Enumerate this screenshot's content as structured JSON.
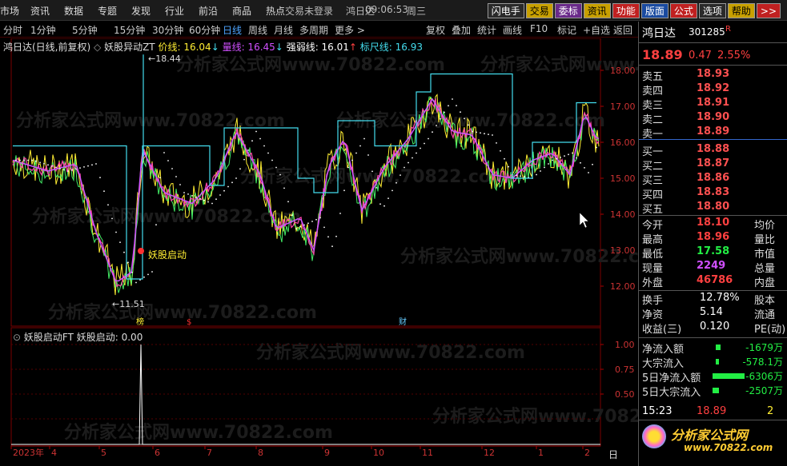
{
  "menubar": {
    "items": [
      "市场",
      "资讯",
      "数据",
      "专题",
      "发现",
      "行业",
      "前沿",
      "商品",
      "热点"
    ],
    "status": "交易未登录",
    "stock_short": "鸿日达",
    "time": "09:06:53",
    "weekday": "周三",
    "buttons": [
      {
        "label": "闪电手",
        "bg": "#2a2a2a",
        "fg": "#ffffff"
      },
      {
        "label": "交易",
        "bg": "#c8a000",
        "fg": "#000000"
      },
      {
        "label": "委标",
        "bg": "#6a2a8a",
        "fg": "#ffffff"
      },
      {
        "label": "资讯",
        "bg": "#c8a000",
        "fg": "#000000"
      },
      {
        "label": "功能",
        "bg": "#c02020",
        "fg": "#ffffff"
      },
      {
        "label": "版面",
        "bg": "#1a4aa0",
        "fg": "#ffffff"
      },
      {
        "label": "公式",
        "bg": "#c02020",
        "fg": "#ffffff"
      },
      {
        "label": "选项",
        "bg": "#2a2a2a",
        "fg": "#ffffff"
      },
      {
        "label": "帮助",
        "bg": "#c8a000",
        "fg": "#000000"
      },
      {
        "label": ">>",
        "bg": "#c02020",
        "fg": "#ffffff"
      }
    ]
  },
  "periods": [
    "分时",
    "1分钟",
    "5分钟",
    "15分钟",
    "30分钟",
    "60分钟",
    "日线",
    "周线",
    "月线",
    "多周期",
    "更多 >"
  ],
  "active_period": "日线",
  "tools": [
    "复权",
    "叠加",
    "统计",
    "画线",
    "F10",
    "标记",
    "+自选",
    "返回"
  ],
  "chart_legend": {
    "stock": "鸿日达(日线,前复权)",
    "indicator": "妖股异动ZT",
    "price_label": "价线: 16.04",
    "vol_label": "量线: 16.45",
    "strong_label": "强弱线: 16.01",
    "ruler_label": "标尺线: 16.93"
  },
  "lower_legend": {
    "indicator": "妖股启动FT",
    "value": "妖股启动: 0.00"
  },
  "annotations": {
    "high": "18.44",
    "low": "11.51",
    "signal": "妖股启动"
  },
  "markers": [
    "榜",
    "$",
    "财"
  ],
  "y_axis_main": [
    "18.00",
    "17.00",
    "16.00",
    "15.00",
    "14.00",
    "13.00",
    "12.00"
  ],
  "y_axis_sub": [
    "1.00",
    "0.75",
    "0.50"
  ],
  "x_axis": [
    "2023年",
    "4",
    "5",
    "6",
    "7",
    "8",
    "9",
    "10",
    "11",
    "12",
    "1",
    "2"
  ],
  "watermark": "分析家公式网www.70822.com",
  "quote": {
    "name": "鸿日达",
    "code": "301285",
    "code_flag": "R",
    "price": "18.89",
    "change": "0.47",
    "pct": "2.55%",
    "asks": [
      {
        "label": "卖五",
        "price": "18.93"
      },
      {
        "label": "卖四",
        "price": "18.92"
      },
      {
        "label": "卖三",
        "price": "18.91"
      },
      {
        "label": "卖二",
        "price": "18.90"
      },
      {
        "label": "卖一",
        "price": "18.89"
      }
    ],
    "bids": [
      {
        "label": "买一",
        "price": "18.88"
      },
      {
        "label": "买二",
        "price": "18.87"
      },
      {
        "label": "买三",
        "price": "18.86"
      },
      {
        "label": "买四",
        "price": "18.83"
      },
      {
        "label": "买五",
        "price": "18.80"
      }
    ],
    "stats": [
      {
        "label": "今开",
        "value": "18.10",
        "label2": "均价",
        "color": "#ff4040"
      },
      {
        "label": "最高",
        "value": "18.96",
        "label2": "量比",
        "color": "#ff4040"
      },
      {
        "label": "最低",
        "value": "17.58",
        "label2": "市值",
        "color": "#22ee44"
      },
      {
        "label": "现量",
        "value": "2249",
        "label2": "总量",
        "color": "#d050ff"
      },
      {
        "label": "外盘",
        "value": "46786",
        "label2": "内盘",
        "color": "#ff4040"
      }
    ],
    "stats2": [
      {
        "label": "换手",
        "value": "12.78%",
        "label2": "股本"
      },
      {
        "label": "净资",
        "value": "5.14",
        "label2": "流通"
      },
      {
        "label": "收益(三)",
        "value": "0.120",
        "label2": "PE(动)"
      }
    ],
    "flows": [
      {
        "label": "净流入额",
        "value": "-1679万"
      },
      {
        "label": "大宗流入",
        "value": "-578.1万"
      },
      {
        "label": "5日净流入额",
        "value": "-6306万"
      },
      {
        "label": "5日大宗流入",
        "value": "-2507万"
      }
    ],
    "tick": {
      "time": "15:23",
      "price": "18.89",
      "vol": "2"
    },
    "logo_text": "分析家公式网",
    "logo_url": "www.70822.com"
  }
}
